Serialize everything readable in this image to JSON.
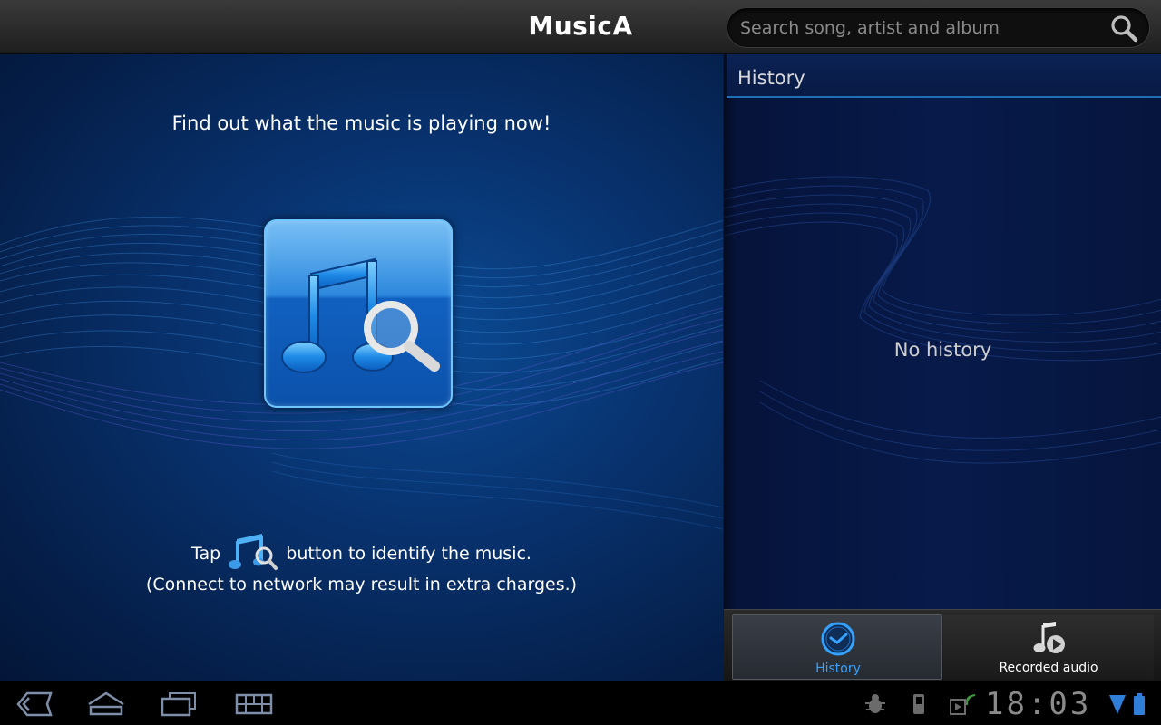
{
  "app": {
    "title": "MusicA"
  },
  "search": {
    "placeholder": "Search song, artist and album",
    "icon": "search-icon"
  },
  "main": {
    "headline": "Find out what the music is playing now!",
    "identify_button_icon": "music-note-search-icon",
    "hint_prefix": "Tap",
    "hint_suffix": "button to identify the music.",
    "hint_note": "(Connect to network may result in extra charges.)"
  },
  "history": {
    "title": "History",
    "empty_text": "No history"
  },
  "tabs": [
    {
      "label": "History",
      "icon": "clock-icon",
      "selected": true
    },
    {
      "label": "Recorded audio",
      "icon": "music-play-icon",
      "selected": false
    }
  ],
  "system_bar": {
    "time": "18:03",
    "nav": [
      "back-icon",
      "home-icon",
      "recent-apps-icon",
      "keyboard-icon"
    ],
    "status_icons": [
      "debug-icon",
      "usb-icon",
      "media-icon",
      "wifi-icon",
      "battery-icon"
    ]
  },
  "colors": {
    "accent_blue": "#35a2ff",
    "panel_blue": "#08326e",
    "history_underline": "#1e6fb4"
  }
}
